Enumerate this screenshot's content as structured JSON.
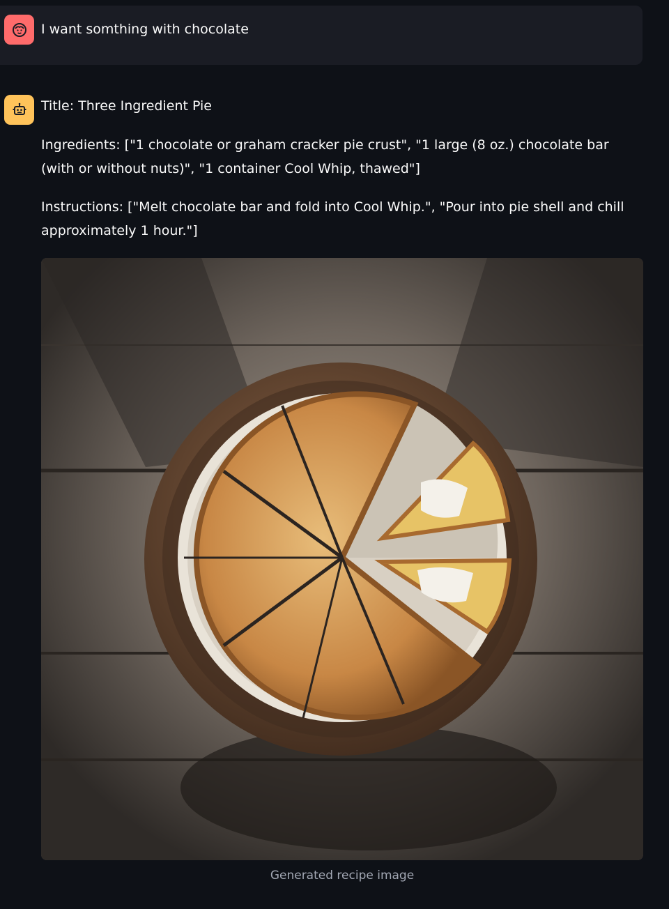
{
  "messages": {
    "user": {
      "avatar_icon": "user-face-icon",
      "text": "I want somthing with chocolate"
    },
    "assistant": {
      "avatar_icon": "robot-icon",
      "title": "Title: Three Ingredient Pie",
      "ingredients": "Ingredients: [\"1 chocolate or graham cracker pie crust\", \"1 large (8 oz.) chocolate bar (with or without nuts)\", \"1 container Cool Whip, thawed\"]",
      "instructions": "Instructions: [\"Melt chocolate bar and fold into Cool Whip.\", \"Pour into pie shell and chill approximately 1 hour.\"]",
      "image_caption": "Generated recipe image"
    }
  },
  "colors": {
    "background": "#0e1117",
    "user_bubble": "#1a1c24",
    "user_avatar": "#ff6b6b",
    "bot_avatar": "#ffc35a",
    "caption_text": "#a3a8b4"
  }
}
